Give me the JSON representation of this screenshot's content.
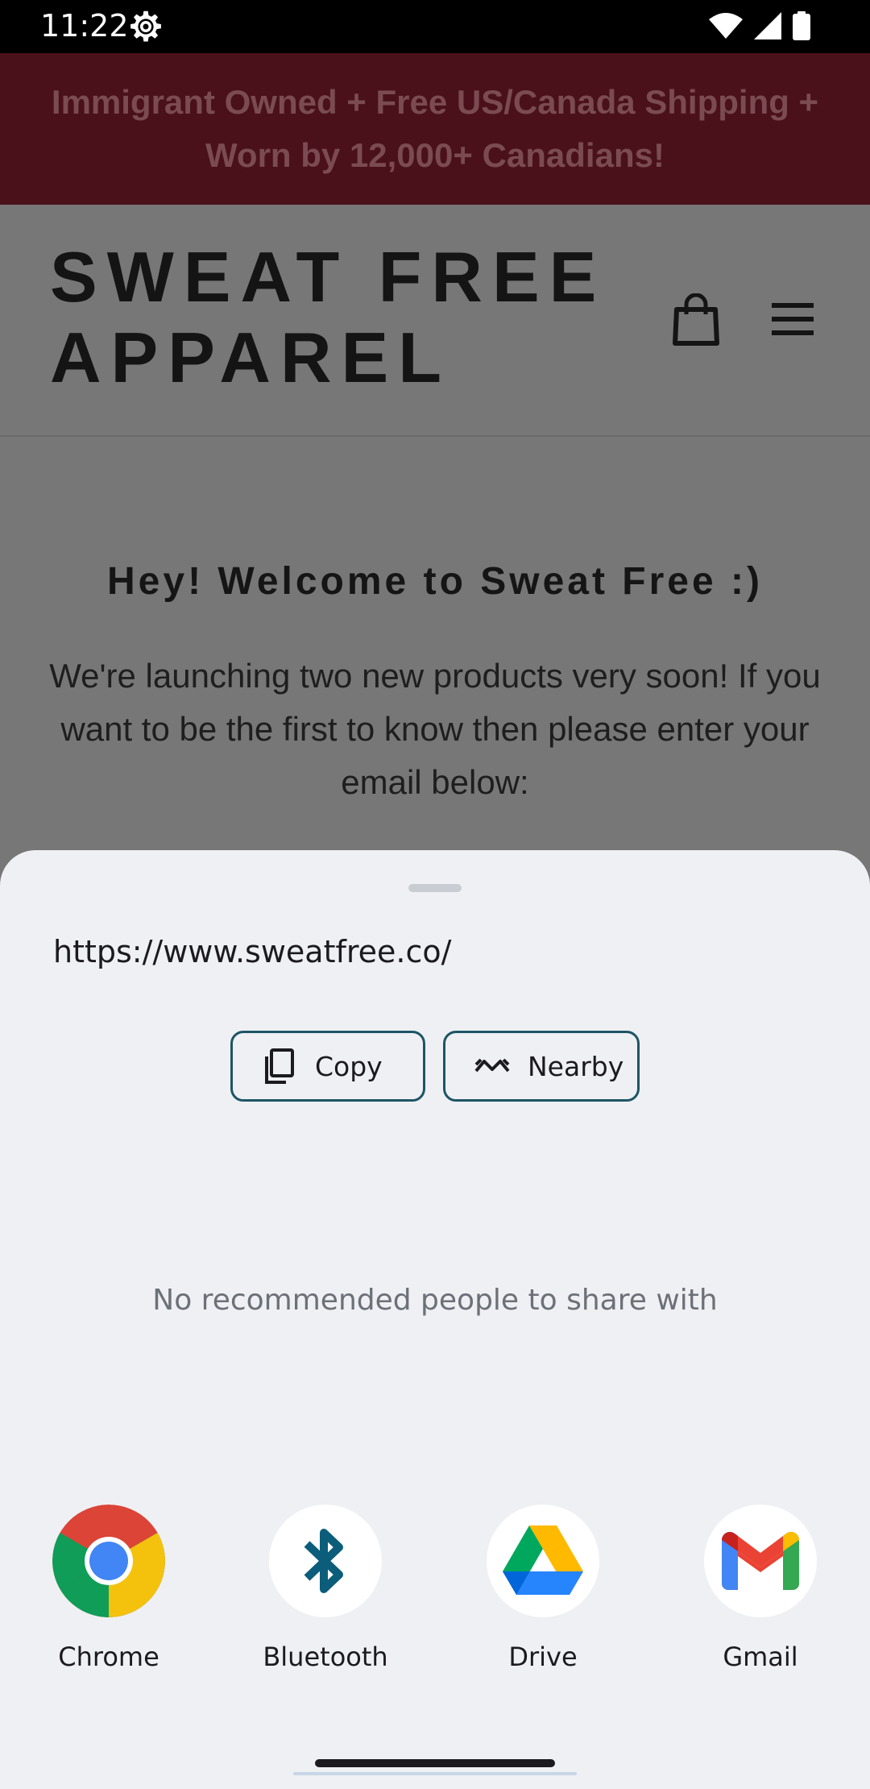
{
  "status_bar": {
    "time": "11:22",
    "icons": [
      "gear-icon",
      "wifi-icon",
      "signal-icon",
      "battery-icon"
    ]
  },
  "website": {
    "announcement": "Immigrant Owned + Free US/Canada Shipping + Worn by 12,000+ Canadians!",
    "brand": "SWEAT FREE APPAREL",
    "welcome_heading": "Hey! Welcome to Sweat Free :)",
    "welcome_body": "We're launching two new products very soon! If you want to be the first to know then please enter your email below:"
  },
  "share_sheet": {
    "url": "https://www.sweatfree.co/",
    "copy_label": "Copy",
    "nearby_label": "Nearby",
    "no_people_text": "No recommended people to share with",
    "apps": [
      {
        "label": "Chrome",
        "icon": "chrome-icon"
      },
      {
        "label": "Bluetooth",
        "icon": "bluetooth-icon"
      },
      {
        "label": "Drive",
        "icon": "drive-icon"
      },
      {
        "label": "Gmail",
        "icon": "gmail-icon"
      }
    ]
  },
  "colors": {
    "announcement_bg": "#4a111a",
    "sheet_bg": "#eff0f3",
    "chip_border": "#1d5566",
    "bluetooth": "#0b5d7a"
  }
}
